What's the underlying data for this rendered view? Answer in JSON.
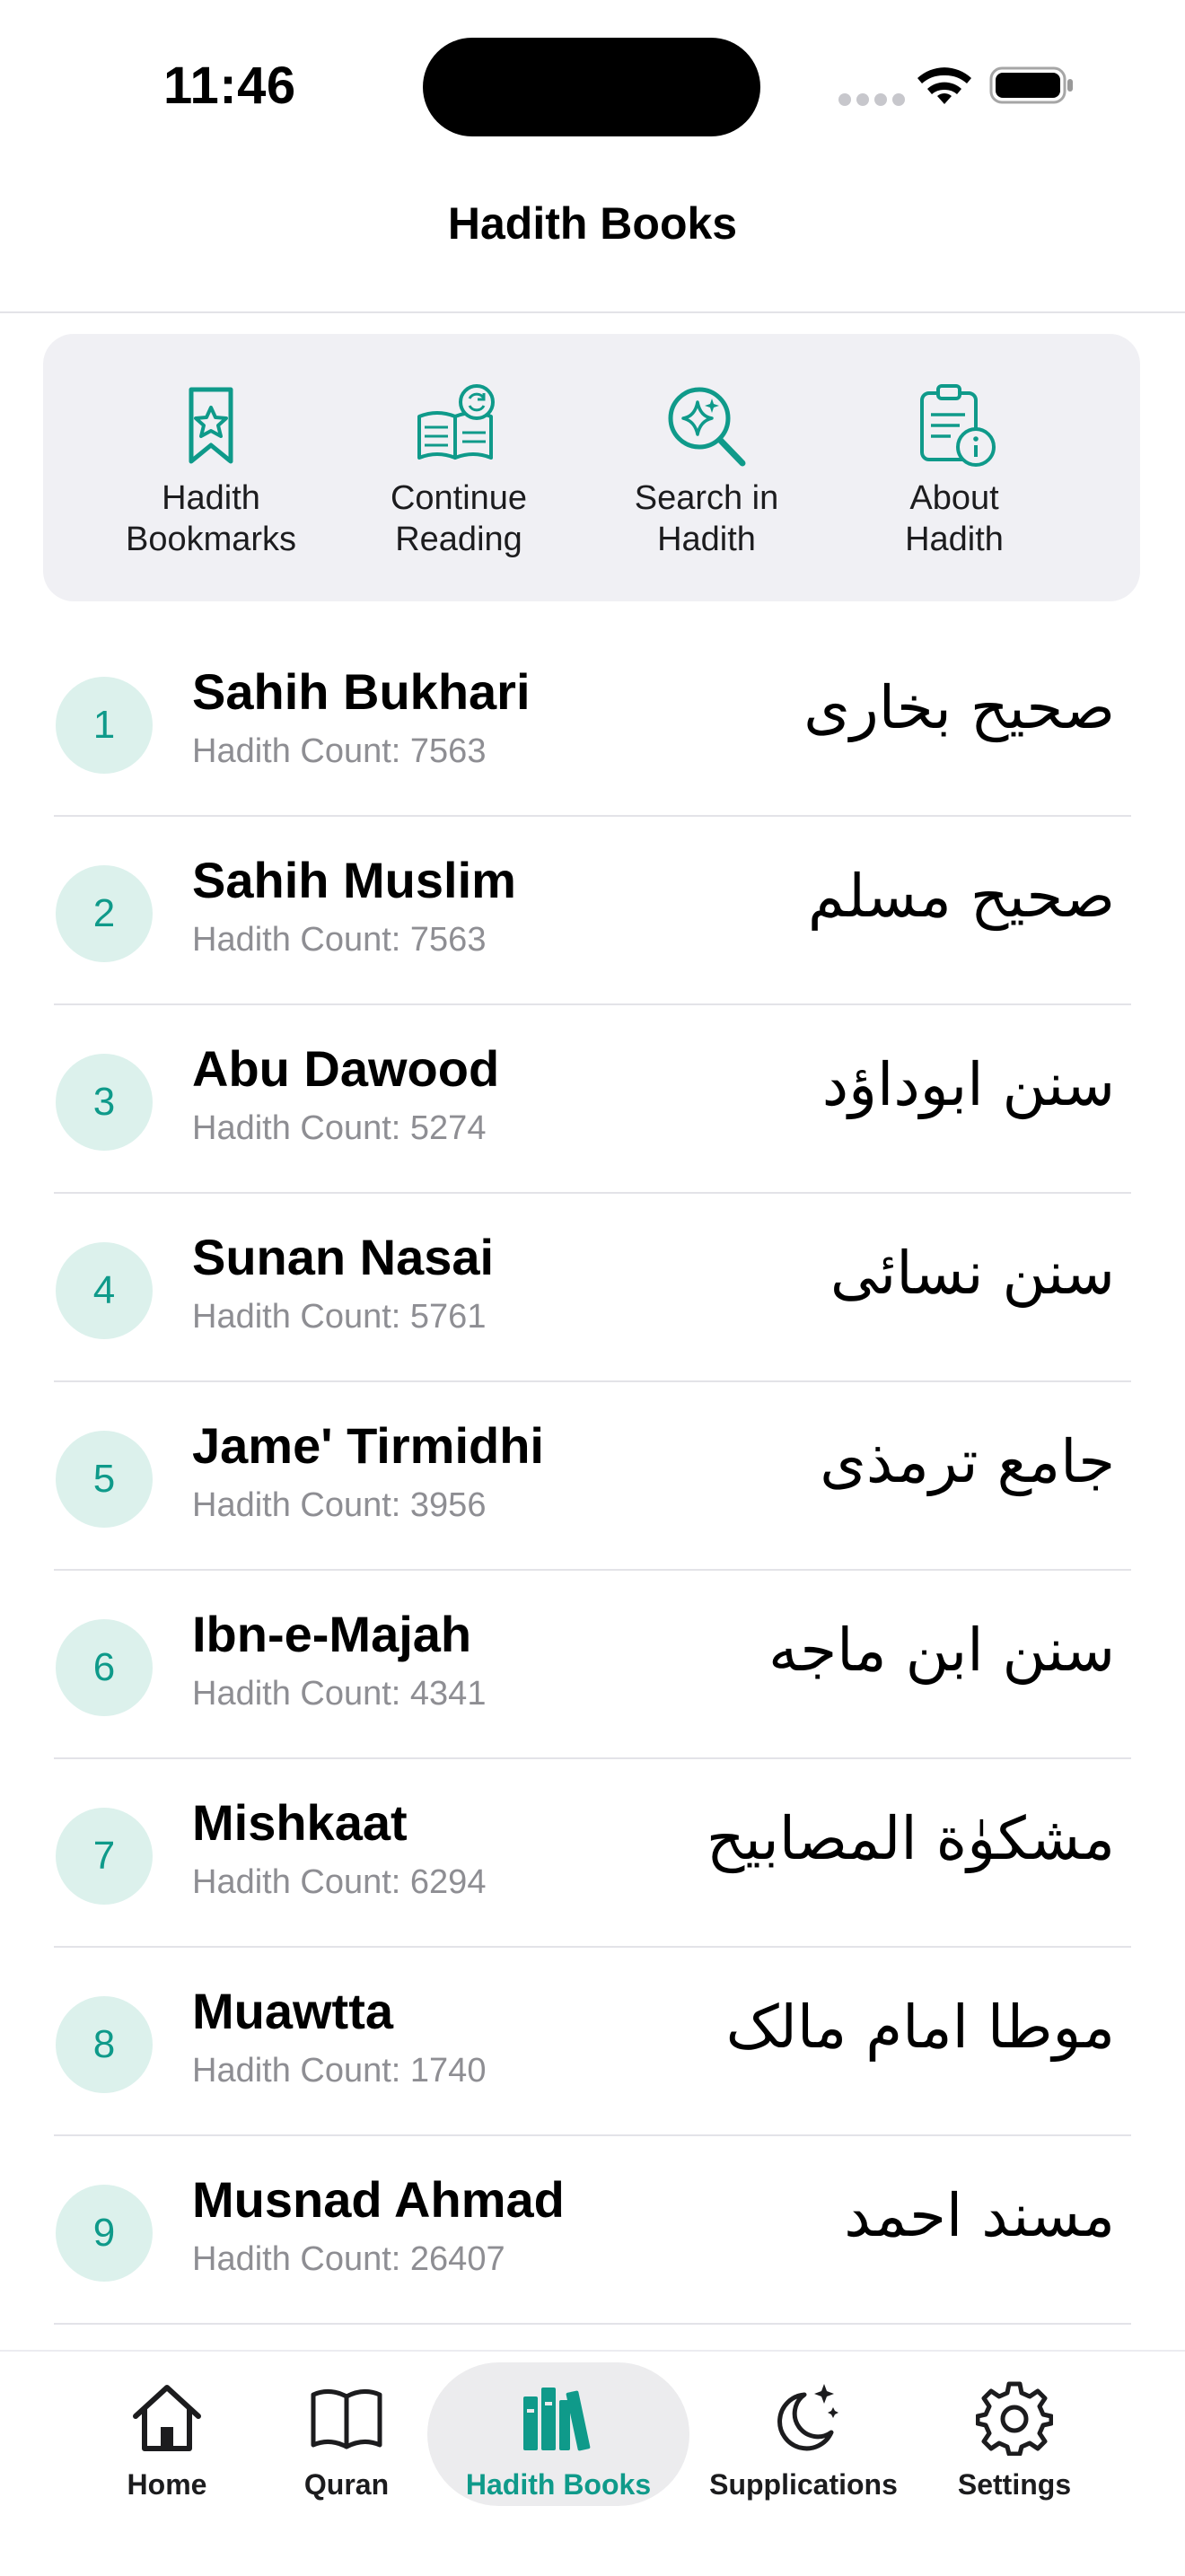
{
  "status": {
    "time": "11:46"
  },
  "header": {
    "title": "Hadith Books"
  },
  "quick_actions": [
    {
      "label": "Hadith\nBookmarks",
      "icon": "bookmark-star-icon"
    },
    {
      "label": "Continue\nReading",
      "icon": "open-book-refresh-icon"
    },
    {
      "label": "Search in\nHadith",
      "icon": "sparkle-search-icon"
    },
    {
      "label": "About\nHadith",
      "icon": "clipboard-info-icon"
    }
  ],
  "books": [
    {
      "num": "1",
      "name": "Sahih Bukhari",
      "count": "Hadith Count: 7563",
      "arabic": "صحیح بخاری"
    },
    {
      "num": "2",
      "name": "Sahih Muslim",
      "count": "Hadith Count: 7563",
      "arabic": "صحیح مسلم"
    },
    {
      "num": "3",
      "name": "Abu Dawood",
      "count": "Hadith Count: 5274",
      "arabic": "سنن ابوداؤد"
    },
    {
      "num": "4",
      "name": "Sunan Nasai",
      "count": "Hadith Count: 5761",
      "arabic": "سنن نسائی"
    },
    {
      "num": "5",
      "name": "Jame' Tirmidhi",
      "count": "Hadith Count: 3956",
      "arabic": "جامع ترمذی"
    },
    {
      "num": "6",
      "name": "Ibn-e-Majah",
      "count": "Hadith Count: 4341",
      "arabic": "سنن ابن ماجه"
    },
    {
      "num": "7",
      "name": "Mishkaat",
      "count": "Hadith Count: 6294",
      "arabic": "مشكوٰة المصابيح"
    },
    {
      "num": "8",
      "name": "Muawtta",
      "count": "Hadith Count: 1740",
      "arabic": "موطا امام مالک"
    },
    {
      "num": "9",
      "name": "Musnad Ahmad",
      "count": "Hadith Count: 26407",
      "arabic": "مسند احمد"
    }
  ],
  "tabs": [
    {
      "label": "Home",
      "icon": "home-icon"
    },
    {
      "label": "Quran",
      "icon": "book-icon"
    },
    {
      "label": "Hadith Books",
      "icon": "books-icon",
      "active": true
    },
    {
      "label": "Supplications",
      "icon": "moon-star-icon"
    },
    {
      "label": "Settings",
      "icon": "gear-icon"
    }
  ],
  "colors": {
    "accent": "#0f9a8a",
    "badge_bg": "#dcf1ec",
    "panel_bg": "#f0f0f4"
  }
}
